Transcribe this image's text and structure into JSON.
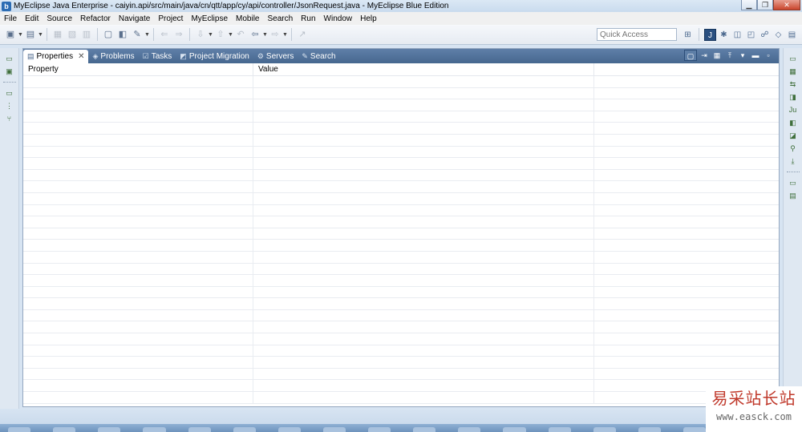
{
  "window": {
    "title": "MyEclipse Java Enterprise - caiyin.api/src/main/java/cn/qtt/app/cy/api/controller/JsonRequest.java - MyEclipse Blue Edition",
    "app_icon_letter": "b"
  },
  "menu": {
    "items": [
      "File",
      "Edit",
      "Source",
      "Refactor",
      "Navigate",
      "Project",
      "MyEclipse",
      "Mobile",
      "Search",
      "Run",
      "Window",
      "Help"
    ]
  },
  "toolbar": {
    "quick_access_placeholder": "Quick Access"
  },
  "view": {
    "tabs": [
      {
        "label": "Properties",
        "icon": "properties-icon",
        "active": true
      },
      {
        "label": "Problems",
        "icon": "problems-icon",
        "active": false
      },
      {
        "label": "Tasks",
        "icon": "tasks-icon",
        "active": false
      },
      {
        "label": "Project Migration",
        "icon": "migration-icon",
        "active": false
      },
      {
        "label": "Servers",
        "icon": "servers-icon",
        "active": false
      },
      {
        "label": "Search",
        "icon": "search-icon",
        "active": false
      }
    ],
    "columns": [
      "Property",
      "Value",
      ""
    ]
  },
  "watermark": {
    "title": "易采站长站",
    "url": "www.easck.com"
  },
  "colors": {
    "tab_bar": "#4f709a",
    "accent": "#294f80"
  }
}
